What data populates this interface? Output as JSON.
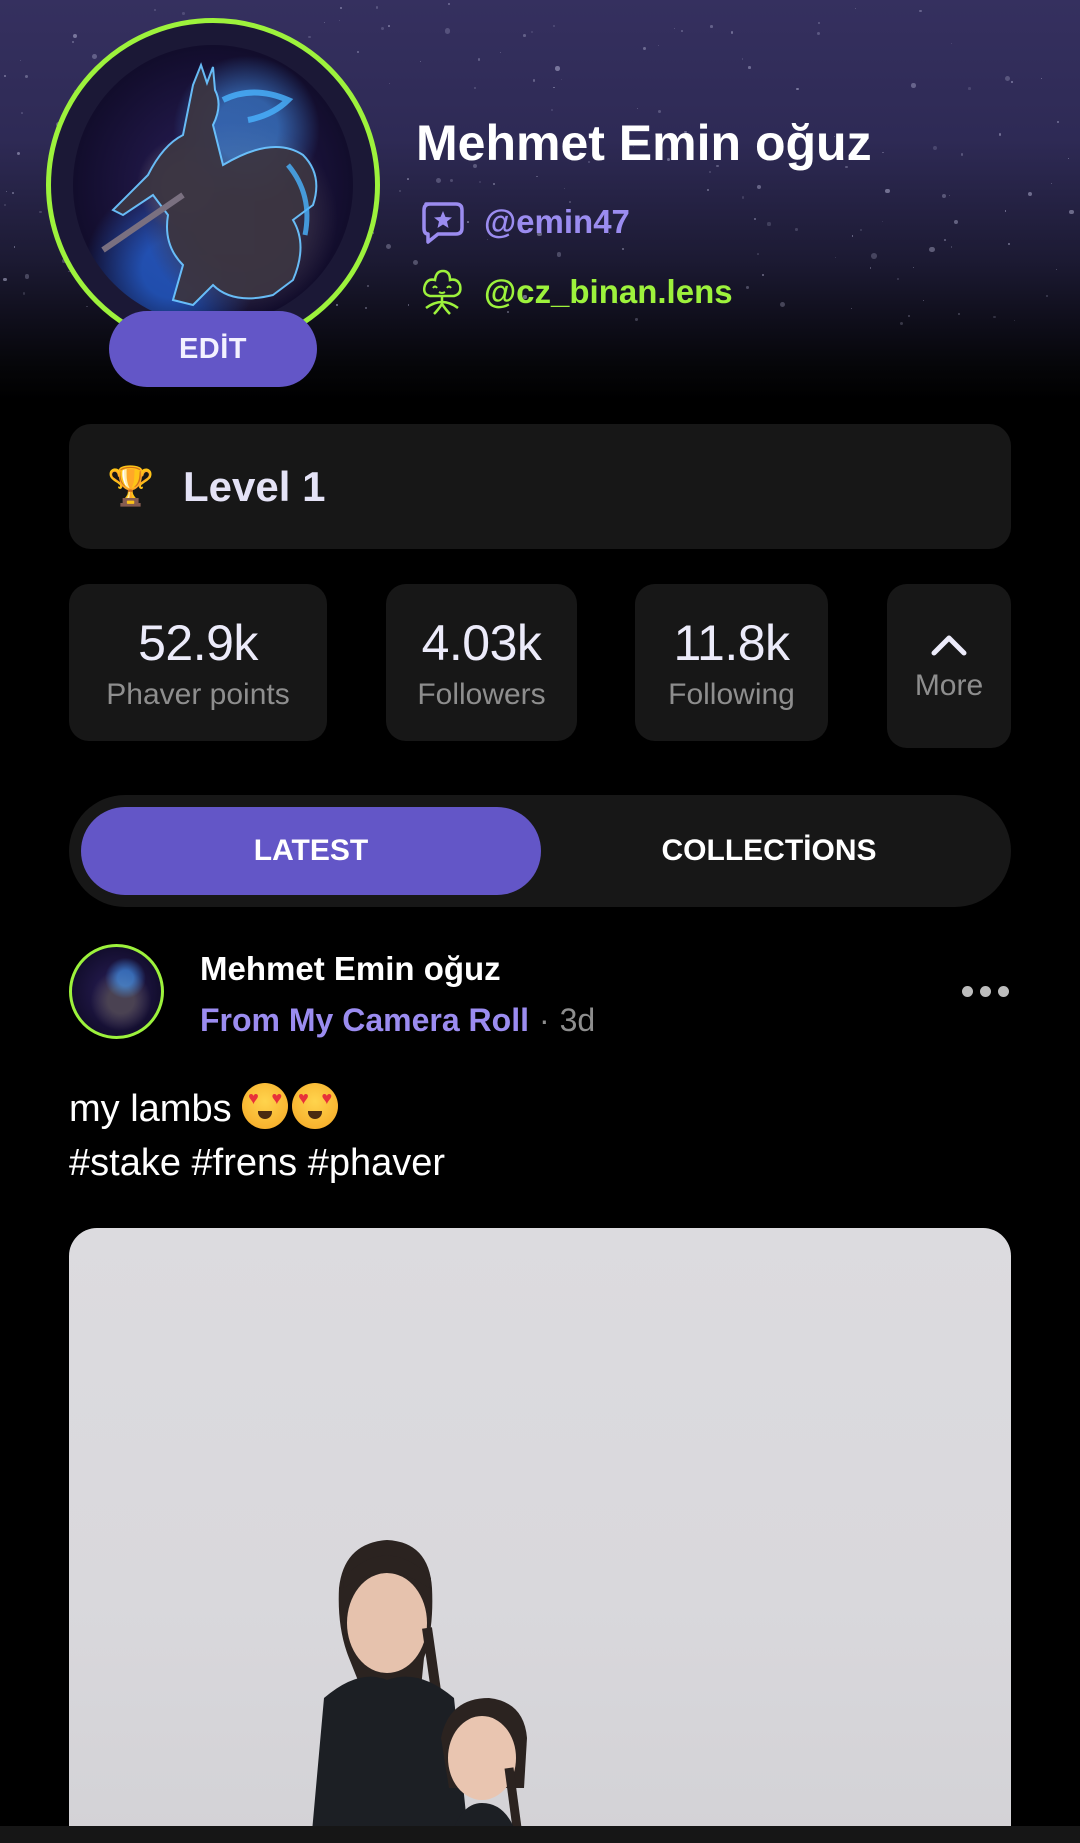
{
  "profile": {
    "name": "Mehmet Emin oğuz",
    "edit_label": "EDİT",
    "handles": [
      {
        "icon": "phaver-chat-star-icon",
        "text": "@emin47",
        "color": "#9b8cf0"
      },
      {
        "icon": "lens-flower-icon",
        "text": "@cz_binan.lens",
        "color": "#9df23c"
      }
    ],
    "avatar_ring_color": "#9df23c"
  },
  "level": {
    "icon": "trophy-icon",
    "label": "Level 1"
  },
  "stats": [
    {
      "value": "52.9k",
      "label": "Phaver points"
    },
    {
      "value": "4.03k",
      "label": "Followers"
    },
    {
      "value": "11.8k",
      "label": "Following"
    }
  ],
  "more": {
    "icon": "chevron-up-icon",
    "label": "More"
  },
  "tabs": [
    {
      "label": "LATEST",
      "active": true
    },
    {
      "label": "COLLECTİONS",
      "active": false
    }
  ],
  "post": {
    "author": "Mehmet Emin oğuz",
    "source": "From My Camera Roll",
    "separator": "·",
    "age": "3d",
    "text_line1": "my lambs",
    "emojis": [
      "smiling-face-with-heart-eyes",
      "smiling-face-with-heart-eyes"
    ],
    "text_line2": "#stake #frens #phaver",
    "image_description": "two girls with braided hair in black dresses against a light grey wall"
  },
  "colors": {
    "accent": "#6356c7",
    "accent_text": "#9b8cf0",
    "lens_green": "#9df23c",
    "card_bg": "#171717",
    "page_bg": "#000000"
  }
}
